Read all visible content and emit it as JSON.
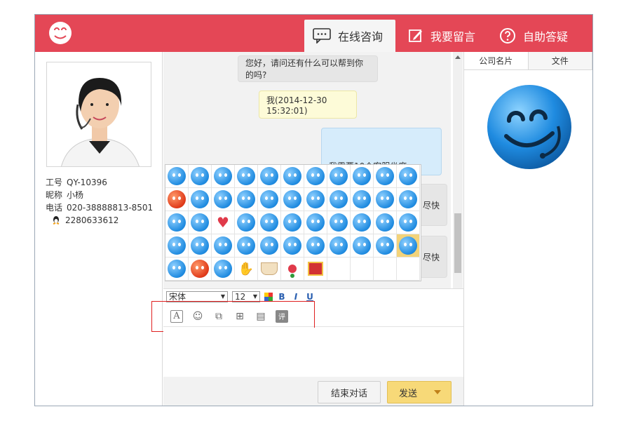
{
  "header": {
    "tabs": [
      {
        "label": "在线咨询",
        "icon": "chat-bubble-icon",
        "active": true
      },
      {
        "label": "我要留言",
        "icon": "edit-icon"
      },
      {
        "label": "自助答疑",
        "icon": "question-icon"
      }
    ],
    "brand_color": "#e44756"
  },
  "agent": {
    "id_label": "工号",
    "id_value": "QY-10396",
    "nick_label": "昵称",
    "nick_value": "小杨",
    "phone_label": "电话",
    "phone_value": "020-38888813-8501",
    "qq_value": "2280633612"
  },
  "chat": {
    "messages": [
      {
        "text": "您好，请问还有什么可以帮到你的吗?"
      },
      {
        "text": "我(2014-12-30 15:32:01)"
      },
      {
        "text": "我需要10个客服坐席"
      },
      {
        "text": "尽快"
      },
      {
        "text": "尽快"
      }
    ]
  },
  "format": {
    "font": "宋体",
    "size": "12",
    "bold": "B",
    "italic": "I",
    "underline": "U"
  },
  "tools": {
    "font_tool": "A",
    "rate_tool": "评"
  },
  "buttons": {
    "end": "结束对话",
    "send": "发送"
  },
  "right_panel": {
    "tabs": [
      "公司名片",
      "文件"
    ]
  }
}
